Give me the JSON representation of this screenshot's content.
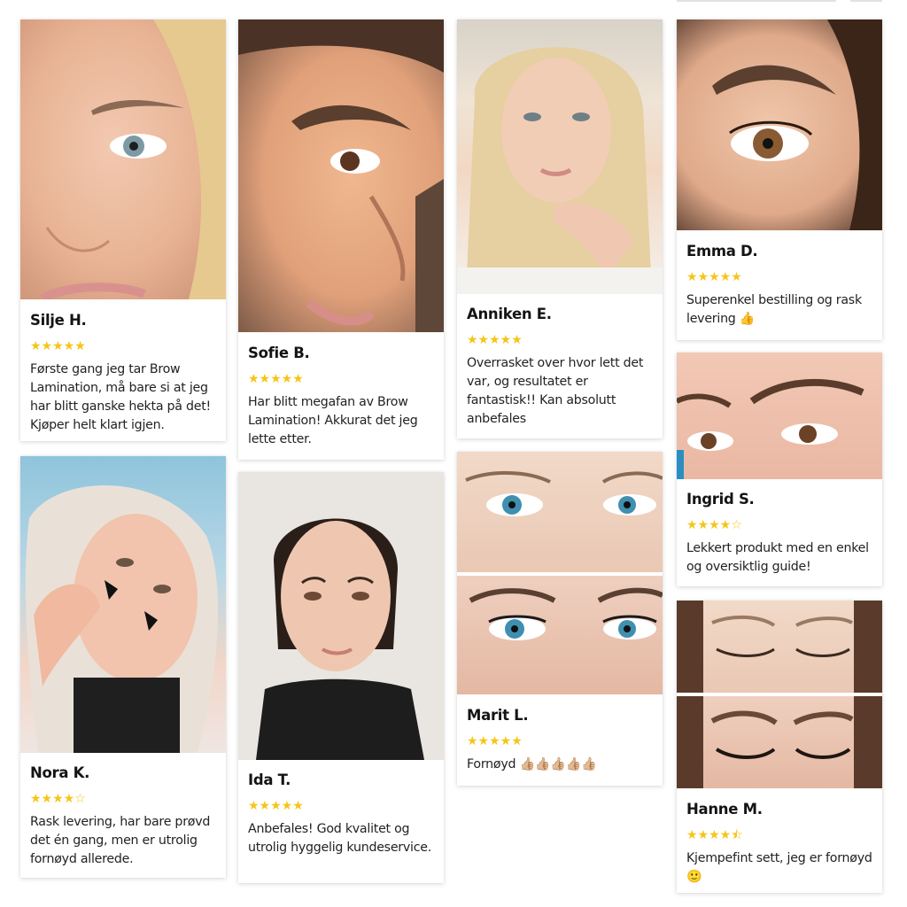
{
  "colors": {
    "star": "#f5c518",
    "star_empty": "#f5c518",
    "card_bg": "#ffffff"
  },
  "reviews": [
    {
      "name": "Silje H.",
      "rating": 5,
      "stars_text": "★★★★★",
      "text": "Første gang jeg tar Brow Lamination, må bare si at jeg har blitt ganske hekta på det! Kjøper helt klart igjen.",
      "photo_alt": "Close-up of woman's eye and brow"
    },
    {
      "name": "Sofie B.",
      "rating": 5,
      "stars_text": "★★★★★",
      "text": "Har blitt megafan av Brow Lamination! Akkurat det jeg lette etter.",
      "photo_alt": "Side profile with laminated brow"
    },
    {
      "name": "Anniken E.",
      "rating": 5,
      "stars_text": "★★★★★",
      "text": "Overrasket over hvor lett det var, og resultatet er fantastisk!! Kan absolutt anbefales",
      "photo_alt": "Blonde woman selfie"
    },
    {
      "name": "Emma D.",
      "rating": 5,
      "stars_text": "★★★★★",
      "text": "Superenkel bestilling og rask levering 👍",
      "photo_alt": "Close-up of brown eye and brow"
    },
    {
      "name": "Ingrid S.",
      "rating": 4,
      "stars_text": "★★★★☆",
      "text": "Lekkert produkt med en enkel og oversiktlig guide!",
      "photo_alt": "Eyes and brows close-up"
    },
    {
      "name": "Nora K.",
      "rating": 4,
      "stars_text": "★★★★☆",
      "text": "Rask levering, har bare prøvd det én gang, men er utrolig fornøyd allerede.",
      "photo_alt": "Blonde woman with heart stickers"
    },
    {
      "name": "Ida T.",
      "rating": 5,
      "stars_text": "★★★★★",
      "text": "Anbefales! God kvalitet og utrolig hyggelig kundeservice.",
      "photo_alt": "Woman with dark hair selfie"
    },
    {
      "name": "Marit L.",
      "rating": 5,
      "stars_text": "★★★★★",
      "text": "Fornøyd 👍🏼👍🏼👍🏼👍🏼👍🏼",
      "photo_alt": "Before and after blue eyes"
    },
    {
      "name": "Hanne M.",
      "rating": 4.5,
      "stars_text": "★★★★⯪",
      "text": "Kjempefint sett, jeg er fornøyd 🙂",
      "photo_alt": "Before and after closed eyes"
    }
  ]
}
